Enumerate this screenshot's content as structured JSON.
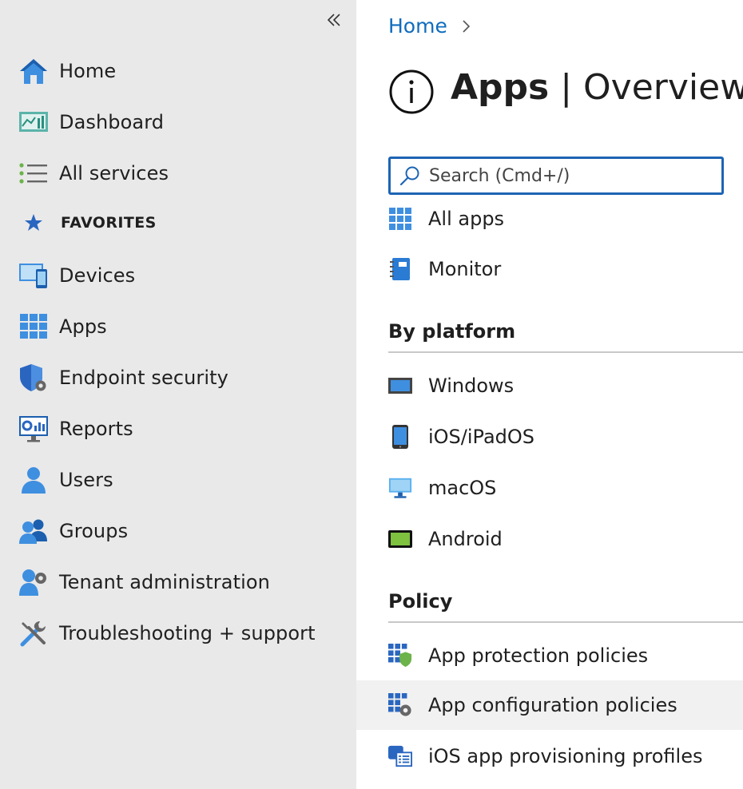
{
  "sidebar": {
    "collapse_icon": "double-chevron-left-icon",
    "items": [
      {
        "label": "Home",
        "icon": "home-icon"
      },
      {
        "label": "Dashboard",
        "icon": "dashboard-icon"
      },
      {
        "label": "All services",
        "icon": "list-icon"
      },
      {
        "label": "Devices",
        "icon": "devices-icon"
      },
      {
        "label": "Apps",
        "icon": "apps-grid-icon"
      },
      {
        "label": "Endpoint security",
        "icon": "shield-gear-icon"
      },
      {
        "label": "Reports",
        "icon": "reports-icon"
      },
      {
        "label": "Users",
        "icon": "user-icon"
      },
      {
        "label": "Groups",
        "icon": "group-icon"
      },
      {
        "label": "Tenant administration",
        "icon": "tenant-admin-icon"
      },
      {
        "label": "Troubleshooting + support",
        "icon": "tools-icon"
      }
    ],
    "favorites_label": "FAVORITES",
    "favorites_icon": "star-icon"
  },
  "main": {
    "breadcrumb": {
      "home": "Home"
    },
    "title": {
      "strong": "Apps",
      "rest": " | Overview"
    },
    "search": {
      "placeholder": "Search (Cmd+/)"
    },
    "top_items": [
      {
        "label": "All apps",
        "icon": "apps-grid-icon"
      },
      {
        "label": "Monitor",
        "icon": "monitor-book-icon"
      }
    ],
    "platform_section": "By platform",
    "platform_items": [
      {
        "label": "Windows",
        "icon": "windows-device-icon"
      },
      {
        "label": "iOS/iPadOS",
        "icon": "ios-device-icon"
      },
      {
        "label": "macOS",
        "icon": "macos-device-icon"
      },
      {
        "label": "Android",
        "icon": "android-device-icon"
      }
    ],
    "policy_section": "Policy",
    "policy_items": [
      {
        "label": "App protection policies",
        "icon": "app-protection-icon"
      },
      {
        "label": "App configuration policies",
        "icon": "app-configuration-icon"
      },
      {
        "label": "iOS app provisioning profiles",
        "icon": "provisioning-profile-icon"
      }
    ]
  },
  "colors": {
    "accent": "#0f6cbd",
    "sidebar_bg": "#e9e9e9",
    "search_border": "#1d64b4",
    "highlight_row": "#f1f1f1"
  }
}
